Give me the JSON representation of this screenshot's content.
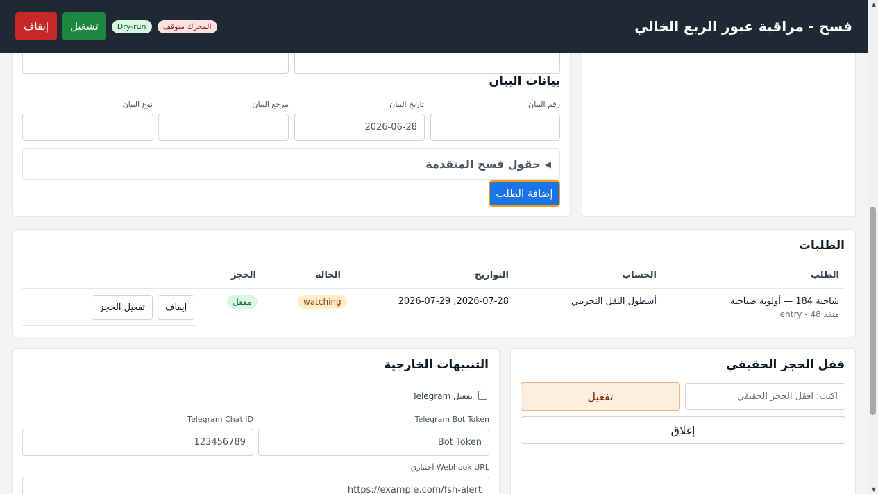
{
  "header": {
    "title": "فسح - مراقبة عبور الربع الخالي",
    "stop_label": "إيقاف",
    "run_label": "تشغيل",
    "dry_run_label": "Dry-run",
    "engine_status": "المحرك متوقف"
  },
  "manifest": {
    "title": "بيانات البيان",
    "number_label": "رقم البيان",
    "date_label": "تاريخ البيان",
    "date_value": "2026-06-28",
    "ref_label": "مرجع البيان",
    "type_label": "نوع البيان",
    "advanced_label": "حقول فسح المتقدمة",
    "add_button": "إضافة الطلب"
  },
  "orders": {
    "title": "الطلبات",
    "columns": [
      "الطلب",
      "الحساب",
      "التواريخ",
      "الحالة",
      "الحجز"
    ],
    "rows": [
      {
        "order": "شاحنة 184 — أولوية صباحية",
        "order_sub": "منفذ 48 - entry",
        "account": "أسطول النقل التجريبي",
        "dates": "2026-07-28, 2026-07-29",
        "status": "watching",
        "booking": "مقفل",
        "stop_button": "إيقاف",
        "enable_button": "تفعيل الحجز"
      }
    ]
  },
  "real_lock": {
    "title": "قفل الحجز الحقيقي",
    "input_placeholder": "اكتب: افقل الحجز الحقيقي",
    "activate_button": "تفعيل",
    "close_button": "إغلاق"
  },
  "alerts": {
    "title": "التنبيهات الخارجية",
    "telegram_enable_label": "تفعيل Telegram",
    "bot_token_label": "Telegram Bot Token",
    "bot_token_value": "Bot Token",
    "chat_id_label": "Telegram Chat ID",
    "chat_id_value": "123456789",
    "webhook_label": "Webhook URL اختياري",
    "webhook_value": "https://example.com/fsh-alert"
  }
}
